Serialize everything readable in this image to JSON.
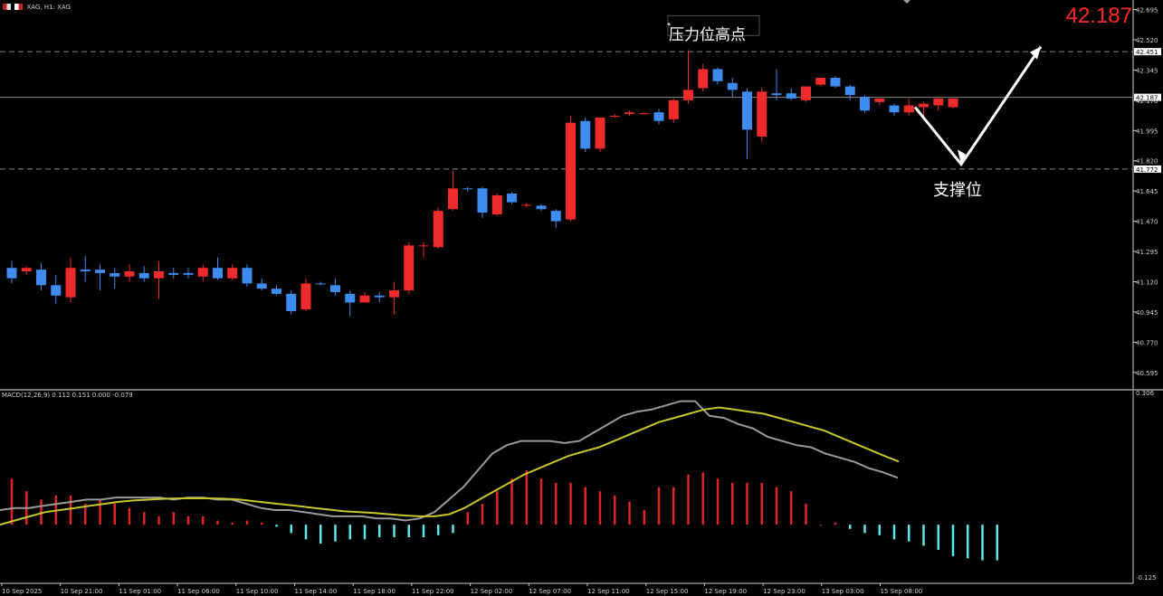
{
  "header": {
    "symbol_label": "XAG, H1: XAG",
    "last_price": "42.187"
  },
  "colors": {
    "background": "#000000",
    "bull": "#f02b2b",
    "bear": "#3f8cf0",
    "grid_dash": "#8a8a8a",
    "macd_line": "#9a9a9a",
    "signal_line": "#c9c62c",
    "hist_pos": "#e02525",
    "hist_neg": "#5ae8ee",
    "annotation": "#ffffff"
  },
  "chart_data": [
    {
      "type": "candlestick",
      "title": "XAG, H1: XAG",
      "ylim": [
        40.5,
        42.75
      ],
      "y_ticks": [
        "42.695",
        "42.520",
        "42.345",
        "42.170",
        "41.995",
        "41.820",
        "41.645",
        "41.470",
        "41.295",
        "41.120",
        "40.945",
        "40.770",
        "40.595"
      ],
      "x_ticks": [
        "10 Sep 2025",
        "10 Sep 21:00",
        "11 Sep 01:00",
        "11 Sep 06:00",
        "11 Sep 10:00",
        "11 Sep 14:00",
        "11 Sep 18:00",
        "11 Sep 22:00",
        "12 Sep 02:00",
        "12 Sep 07:00",
        "12 Sep 11:00",
        "12 Sep 15:00",
        "12 Sep 19:00",
        "12 Sep 23:00",
        "13 Sep 03:00",
        "15 Sep 08:00"
      ],
      "levels": [
        {
          "label": "42.451",
          "value": 42.451,
          "style": "dashed"
        },
        {
          "label": "42.187",
          "value": 42.187,
          "style": "solid"
        },
        {
          "label": "41.772",
          "value": 41.772,
          "style": "dashed"
        }
      ],
      "annotations": [
        {
          "text": "压力位高点"
        },
        {
          "text": "支撑位"
        }
      ],
      "candles": [
        {
          "o": 41.2,
          "h": 41.24,
          "l": 41.11,
          "c": 41.14
        },
        {
          "o": 41.18,
          "h": 41.21,
          "l": 41.16,
          "c": 41.2
        },
        {
          "o": 41.19,
          "h": 41.23,
          "l": 41.07,
          "c": 41.1
        },
        {
          "o": 41.1,
          "h": 41.16,
          "l": 40.99,
          "c": 41.04
        },
        {
          "o": 41.03,
          "h": 41.26,
          "l": 41.0,
          "c": 41.2
        },
        {
          "o": 41.19,
          "h": 41.27,
          "l": 41.12,
          "c": 41.18
        },
        {
          "o": 41.19,
          "h": 41.22,
          "l": 41.07,
          "c": 41.17
        },
        {
          "o": 41.17,
          "h": 41.2,
          "l": 41.08,
          "c": 41.15
        },
        {
          "o": 41.15,
          "h": 41.22,
          "l": 41.12,
          "c": 41.18
        },
        {
          "o": 41.17,
          "h": 41.21,
          "l": 41.12,
          "c": 41.14
        },
        {
          "o": 41.14,
          "h": 41.24,
          "l": 41.02,
          "c": 41.18
        },
        {
          "o": 41.17,
          "h": 41.2,
          "l": 41.14,
          "c": 41.16
        },
        {
          "o": 41.17,
          "h": 41.2,
          "l": 41.14,
          "c": 41.16
        },
        {
          "o": 41.15,
          "h": 41.22,
          "l": 41.12,
          "c": 41.2
        },
        {
          "o": 41.2,
          "h": 41.26,
          "l": 41.13,
          "c": 41.14
        },
        {
          "o": 41.14,
          "h": 41.22,
          "l": 41.13,
          "c": 41.2
        },
        {
          "o": 41.2,
          "h": 41.22,
          "l": 41.09,
          "c": 41.11
        },
        {
          "o": 41.11,
          "h": 41.14,
          "l": 41.07,
          "c": 41.08
        },
        {
          "o": 41.08,
          "h": 41.1,
          "l": 41.04,
          "c": 41.05
        },
        {
          "o": 41.05,
          "h": 41.07,
          "l": 40.93,
          "c": 40.95
        },
        {
          "o": 40.96,
          "h": 41.14,
          "l": 40.95,
          "c": 41.11
        },
        {
          "o": 41.11,
          "h": 41.12,
          "l": 41.1,
          "c": 41.105
        },
        {
          "o": 41.1,
          "h": 41.14,
          "l": 41.04,
          "c": 41.06
        },
        {
          "o": 41.05,
          "h": 41.07,
          "l": 40.92,
          "c": 41.0
        },
        {
          "o": 41.0,
          "h": 41.06,
          "l": 41.0,
          "c": 41.04
        },
        {
          "o": 41.04,
          "h": 41.06,
          "l": 41.0,
          "c": 41.03
        },
        {
          "o": 41.03,
          "h": 41.12,
          "l": 40.93,
          "c": 41.07
        },
        {
          "o": 41.07,
          "h": 41.35,
          "l": 41.05,
          "c": 41.33
        },
        {
          "o": 41.33,
          "h": 41.35,
          "l": 41.26,
          "c": 41.33
        },
        {
          "o": 41.32,
          "h": 41.55,
          "l": 41.31,
          "c": 41.53
        },
        {
          "o": 41.54,
          "h": 41.76,
          "l": 41.53,
          "c": 41.66
        },
        {
          "o": 41.66,
          "h": 41.67,
          "l": 41.64,
          "c": 41.655
        },
        {
          "o": 41.66,
          "h": 41.67,
          "l": 41.49,
          "c": 41.52
        },
        {
          "o": 41.51,
          "h": 41.63,
          "l": 41.5,
          "c": 41.62
        },
        {
          "o": 41.63,
          "h": 41.64,
          "l": 41.57,
          "c": 41.58
        },
        {
          "o": 41.56,
          "h": 41.575,
          "l": 41.55,
          "c": 41.565
        },
        {
          "o": 41.56,
          "h": 41.57,
          "l": 41.53,
          "c": 41.54
        },
        {
          "o": 41.53,
          "h": 41.54,
          "l": 41.43,
          "c": 41.47
        },
        {
          "o": 41.48,
          "h": 42.08,
          "l": 41.47,
          "c": 42.04
        },
        {
          "o": 42.05,
          "h": 42.07,
          "l": 41.87,
          "c": 41.89
        },
        {
          "o": 41.89,
          "h": 42.07,
          "l": 41.87,
          "c": 42.07
        },
        {
          "o": 42.08,
          "h": 42.09,
          "l": 42.07,
          "c": 42.08
        },
        {
          "o": 42.09,
          "h": 42.11,
          "l": 42.08,
          "c": 42.1
        },
        {
          "o": 42.09,
          "h": 42.1,
          "l": 42.09,
          "c": 42.095
        },
        {
          "o": 42.1,
          "h": 42.12,
          "l": 42.03,
          "c": 42.05
        },
        {
          "o": 42.06,
          "h": 42.18,
          "l": 42.04,
          "c": 42.17
        },
        {
          "o": 42.17,
          "h": 42.46,
          "l": 42.15,
          "c": 42.23
        },
        {
          "o": 42.24,
          "h": 42.38,
          "l": 42.22,
          "c": 42.35
        },
        {
          "o": 42.35,
          "h": 42.36,
          "l": 42.26,
          "c": 42.28
        },
        {
          "o": 42.27,
          "h": 42.3,
          "l": 42.19,
          "c": 42.23
        },
        {
          "o": 42.22,
          "h": 42.24,
          "l": 41.83,
          "c": 42.0
        },
        {
          "o": 41.96,
          "h": 42.24,
          "l": 41.93,
          "c": 42.22
        },
        {
          "o": 42.21,
          "h": 42.35,
          "l": 42.17,
          "c": 42.2
        },
        {
          "o": 42.21,
          "h": 42.24,
          "l": 42.17,
          "c": 42.18
        },
        {
          "o": 42.17,
          "h": 42.25,
          "l": 42.16,
          "c": 42.25
        },
        {
          "o": 42.26,
          "h": 42.29,
          "l": 42.25,
          "c": 42.3
        },
        {
          "o": 42.3,
          "h": 42.31,
          "l": 42.24,
          "c": 42.25
        },
        {
          "o": 42.25,
          "h": 42.26,
          "l": 42.17,
          "c": 42.2
        },
        {
          "o": 42.19,
          "h": 42.2,
          "l": 42.1,
          "c": 42.11
        },
        {
          "o": 42.16,
          "h": 42.18,
          "l": 42.14,
          "c": 42.18
        },
        {
          "o": 42.14,
          "h": 42.15,
          "l": 42.08,
          "c": 42.1
        },
        {
          "o": 42.1,
          "h": 42.18,
          "l": 42.08,
          "c": 42.14
        },
        {
          "o": 42.13,
          "h": 42.16,
          "l": 42.05,
          "c": 42.15
        },
        {
          "o": 42.14,
          "h": 42.17,
          "l": 42.11,
          "c": 42.18
        },
        {
          "o": 42.13,
          "h": 42.18,
          "l": 42.12,
          "c": 42.18
        }
      ],
      "forecast_path": [
        "42.13",
        "41.80",
        "42.48"
      ]
    },
    {
      "type": "bar",
      "title": "MACD(12,26,9) 0.112 0.151 0.000 -0.079",
      "ylim": [
        -0.14,
        0.32
      ],
      "y_ticks": [
        "0.306",
        "-0.125"
      ],
      "series": [
        {
          "name": "histogram",
          "values": [
            0.11,
            0.08,
            0.06,
            0.07,
            0.07,
            0.05,
            0.06,
            0.05,
            0.04,
            0.03,
            0.02,
            0.03,
            0.02,
            0.02,
            0.01,
            0.005,
            0.01,
            0.005,
            -0.005,
            -0.02,
            -0.035,
            -0.045,
            -0.04,
            -0.035,
            -0.035,
            -0.03,
            -0.03,
            -0.03,
            -0.03,
            -0.025,
            -0.02,
            0.03,
            0.05,
            0.08,
            0.11,
            0.13,
            0.11,
            0.1,
            0.1,
            0.09,
            0.08,
            0.07,
            0.055,
            0.035,
            0.09,
            0.09,
            0.12,
            0.125,
            0.11,
            0.1,
            0.1,
            0.1,
            0.09,
            0.08,
            0.05,
            0.0,
            0.005,
            -0.01,
            -0.02,
            -0.025,
            -0.035,
            -0.04,
            -0.05,
            -0.06,
            -0.075,
            -0.08,
            -0.085,
            -0.085
          ]
        },
        {
          "name": "macd",
          "values": [
            0.035,
            0.04,
            0.04,
            0.045,
            0.05,
            0.055,
            0.06,
            0.06,
            0.065,
            0.065,
            0.065,
            0.065,
            0.06,
            0.065,
            0.065,
            0.06,
            0.06,
            0.05,
            0.04,
            0.035,
            0.035,
            0.03,
            0.025,
            0.02,
            0.02,
            0.02,
            0.015,
            0.015,
            0.01,
            0.015,
            0.03,
            0.06,
            0.09,
            0.13,
            0.17,
            0.19,
            0.2,
            0.2,
            0.2,
            0.195,
            0.2,
            0.22,
            0.24,
            0.26,
            0.27,
            0.275,
            0.285,
            0.295,
            0.295,
            0.26,
            0.255,
            0.24,
            0.23,
            0.21,
            0.2,
            0.19,
            0.185,
            0.17,
            0.16,
            0.15,
            0.135,
            0.125,
            0.112
          ]
        },
        {
          "name": "signal",
          "values": [
            0.0,
            0.01,
            0.02,
            0.03,
            0.035,
            0.04,
            0.045,
            0.05,
            0.055,
            0.058,
            0.06,
            0.062,
            0.063,
            0.063,
            0.063,
            0.062,
            0.06,
            0.056,
            0.052,
            0.048,
            0.044,
            0.04,
            0.036,
            0.032,
            0.03,
            0.028,
            0.025,
            0.022,
            0.02,
            0.02,
            0.025,
            0.04,
            0.06,
            0.08,
            0.1,
            0.12,
            0.135,
            0.15,
            0.165,
            0.175,
            0.185,
            0.2,
            0.215,
            0.23,
            0.245,
            0.255,
            0.265,
            0.275,
            0.28,
            0.275,
            0.27,
            0.265,
            0.255,
            0.245,
            0.235,
            0.225,
            0.21,
            0.195,
            0.18,
            0.165,
            0.151
          ]
        }
      ]
    }
  ]
}
